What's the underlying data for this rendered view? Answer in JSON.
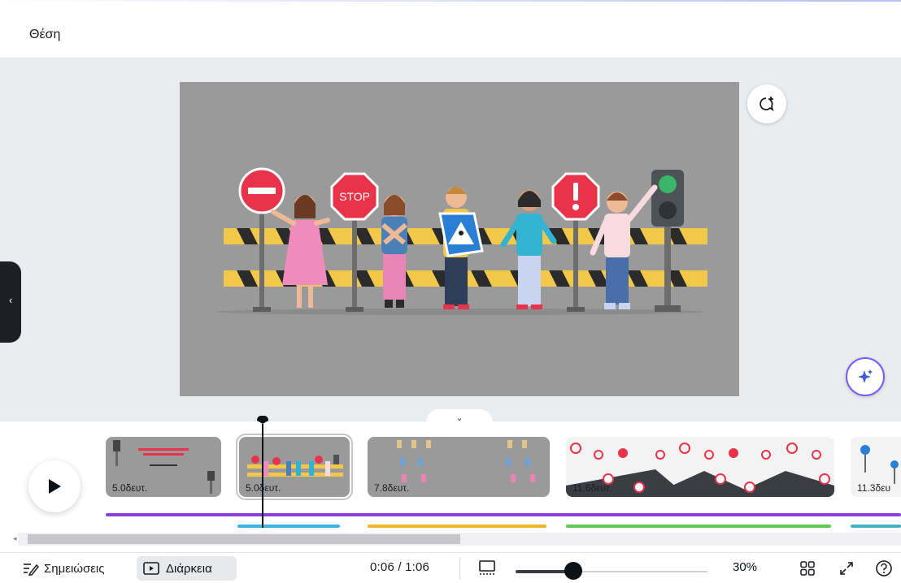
{
  "header": {
    "title": "Θέση"
  },
  "timeline": {
    "clips": [
      {
        "duration": "5.0δευτ."
      },
      {
        "duration": "5.0δευτ."
      },
      {
        "duration": "7.8δευτ."
      },
      {
        "duration": "11.6δευτ."
      },
      {
        "duration": "11.3δευ"
      }
    ],
    "playhead_time_fraction": 0.0909
  },
  "footer": {
    "notes_label": "Σημειώσεις",
    "duration_label": "Διάρκεια",
    "time_display": "0:06 / 1:06",
    "zoom_value": "30%",
    "zoom_fraction": 0.3
  },
  "slide_text": {
    "stop_sign": "STOP"
  },
  "colors": {
    "purple_track": "#8b3fd9",
    "blue_track": "#3fb3e6",
    "yellow_track": "#f2b531",
    "green_track": "#5ccf52",
    "teal_track": "#3fb3c2"
  }
}
